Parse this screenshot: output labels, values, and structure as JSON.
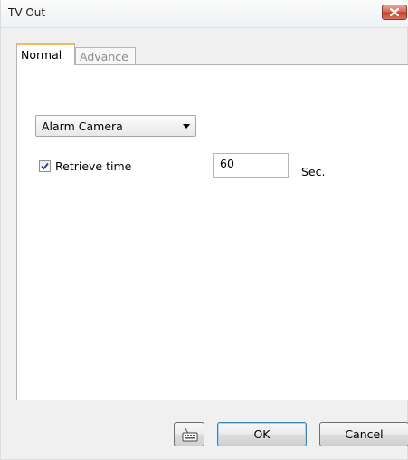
{
  "window": {
    "title": "TV Out",
    "close_icon": "close-icon"
  },
  "tabs": [
    {
      "label": "Normal",
      "selected": true
    },
    {
      "label": "Advance",
      "selected": false
    }
  ],
  "normal_tab": {
    "camera_select": {
      "value": "Alarm Camera",
      "icon": "chevron-down-icon"
    },
    "retrieve_time": {
      "label": "Retrieve time",
      "checked": true,
      "value": "60",
      "unit": "Sec."
    }
  },
  "buttons": {
    "keyboard_icon": "keyboard-icon",
    "ok": "OK",
    "cancel": "Cancel"
  },
  "colors": {
    "close_button": "#d0553f",
    "active_tab_accent": "#f5b85a",
    "default_button_border": "#3c7fb1"
  }
}
